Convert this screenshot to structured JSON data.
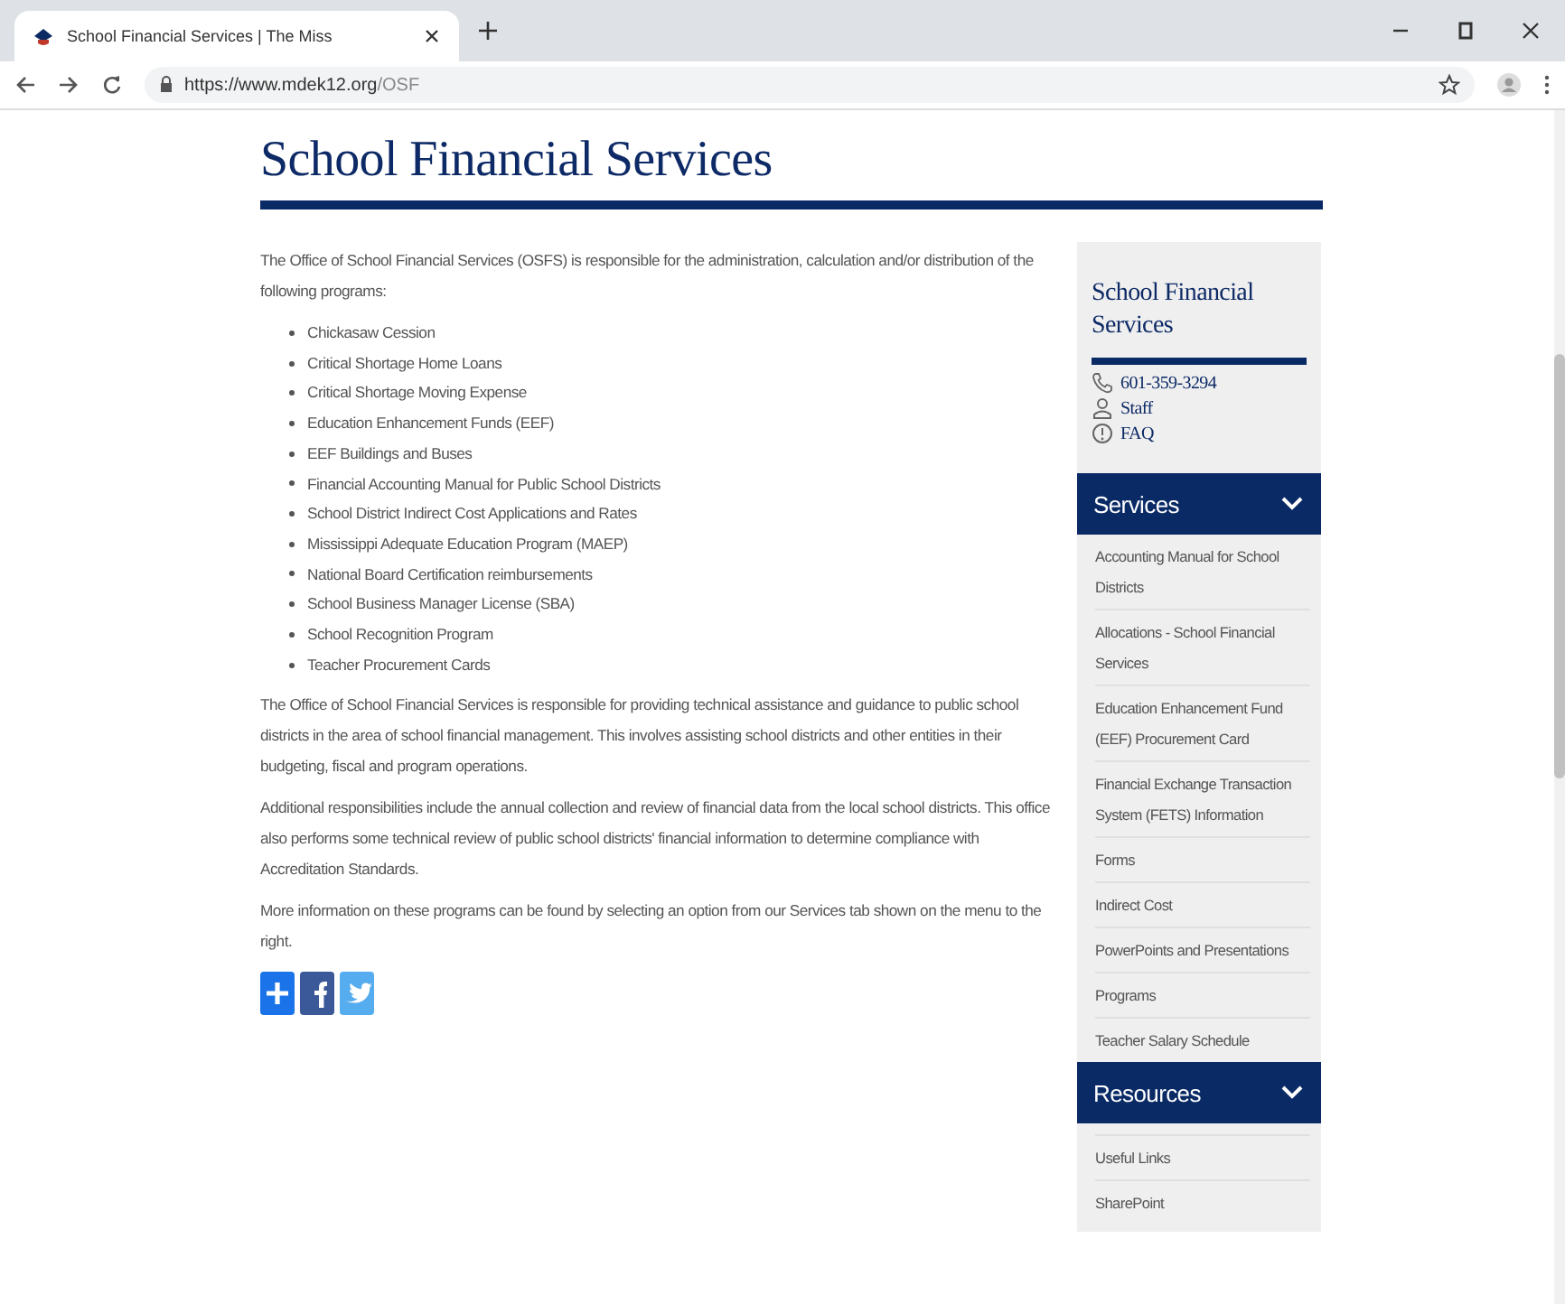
{
  "browser": {
    "tab": {
      "title": "School Financial Services | The Miss"
    },
    "url_host": "https://www.mdek12.org",
    "url_path": "/OSF"
  },
  "page": {
    "title": "School Financial Services",
    "intro": "The Office of School Financial Services (OSFS) is responsible for the administration, calculation and/or distribution of the following programs:",
    "programs": [
      "Chickasaw Cession",
      "Critical Shortage Home Loans",
      "Critical Shortage Moving Expense",
      "Education Enhancement Funds (EEF)",
      "EEF Buildings and Buses",
      "Financial Accounting Manual for Public School Districts",
      "School District Indirect Cost Applications and Rates",
      "Mississippi Adequate Education Program (MAEP)",
      "National Board Certification reimbursements",
      "School Business Manager License (SBA)",
      "School Recognition Program",
      "Teacher Procurement Cards"
    ],
    "paragraphs": [
      "The Office of School Financial Services is responsible for providing technical assistance and guidance to public school districts in the area of school financial management. This involves assisting school districts and other entities in their budgeting, fiscal and program operations.",
      "Additional responsibilities include the annual collection and review of financial data from the local school districts.  This office also performs some technical review of public school districts' financial information to determine compliance with Accreditation Standards.",
      "More information on these programs can be found by selecting an option from our Services tab shown on the menu to the right."
    ],
    "share_buttons": [
      {
        "kind": "share"
      },
      {
        "kind": "facebook"
      },
      {
        "kind": "twitter"
      }
    ]
  },
  "sidebar": {
    "title": "School Financial Services",
    "contacts": [
      {
        "kind": "phone",
        "text": "601-359-3294"
      },
      {
        "kind": "person",
        "text": "Staff"
      },
      {
        "kind": "help",
        "text": "FAQ"
      }
    ],
    "sections": [
      {
        "title": "Services",
        "expanded": true,
        "items": [
          "Accounting Manual for School Districts",
          "Allocations - School Financial Services",
          "Education Enhancement Fund (EEF) Procurement Card",
          "Financial Exchange Transaction System (FETS) Information",
          "Forms",
          "Indirect Cost",
          "PowerPoints and Presentations",
          "Programs",
          "Teacher Salary Schedule"
        ]
      },
      {
        "title": "Resources",
        "expanded": true,
        "items": [
          "Useful Links",
          "SharePoint"
        ]
      }
    ]
  }
}
